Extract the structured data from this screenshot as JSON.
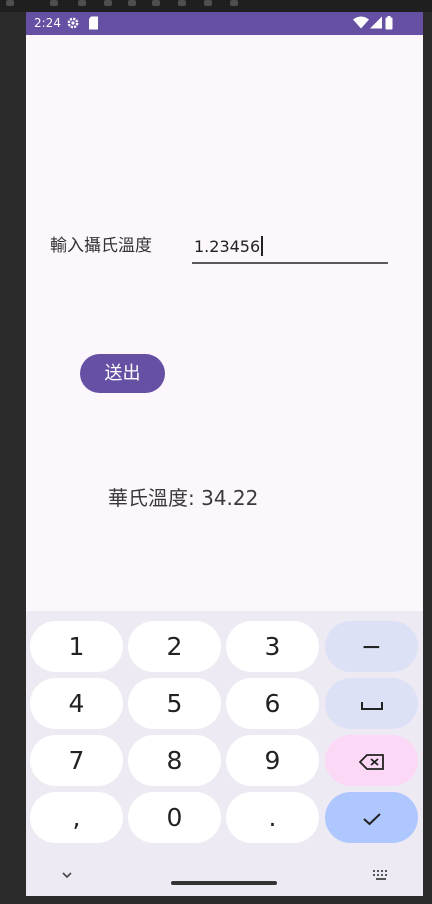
{
  "status_bar": {
    "time": "2:24",
    "icons": [
      "settings-icon",
      "sd-card-icon",
      "wifi-icon",
      "signal-icon"
    ]
  },
  "form": {
    "label": "輸入攝氏溫度",
    "input_value": "1.23456"
  },
  "submit": {
    "label": "送出"
  },
  "result": {
    "text": "華氏溫度: 34.22"
  },
  "keyboard": {
    "rows": [
      [
        {
          "label": "1"
        },
        {
          "label": "2"
        },
        {
          "label": "3"
        },
        {
          "label": "−",
          "type": "func"
        }
      ],
      [
        {
          "label": "4"
        },
        {
          "label": "5"
        },
        {
          "label": "6"
        },
        {
          "label": "space",
          "type": "func"
        }
      ],
      [
        {
          "label": "7"
        },
        {
          "label": "8"
        },
        {
          "label": "9"
        },
        {
          "label": "delete",
          "type": "del"
        }
      ],
      [
        {
          "label": ","
        },
        {
          "label": "0"
        },
        {
          "label": "."
        },
        {
          "label": "done",
          "type": "ok"
        }
      ]
    ]
  },
  "colors": {
    "accent": "#6550a4",
    "background": "#fcf6fd",
    "keyboard": "#eeeaf3"
  }
}
